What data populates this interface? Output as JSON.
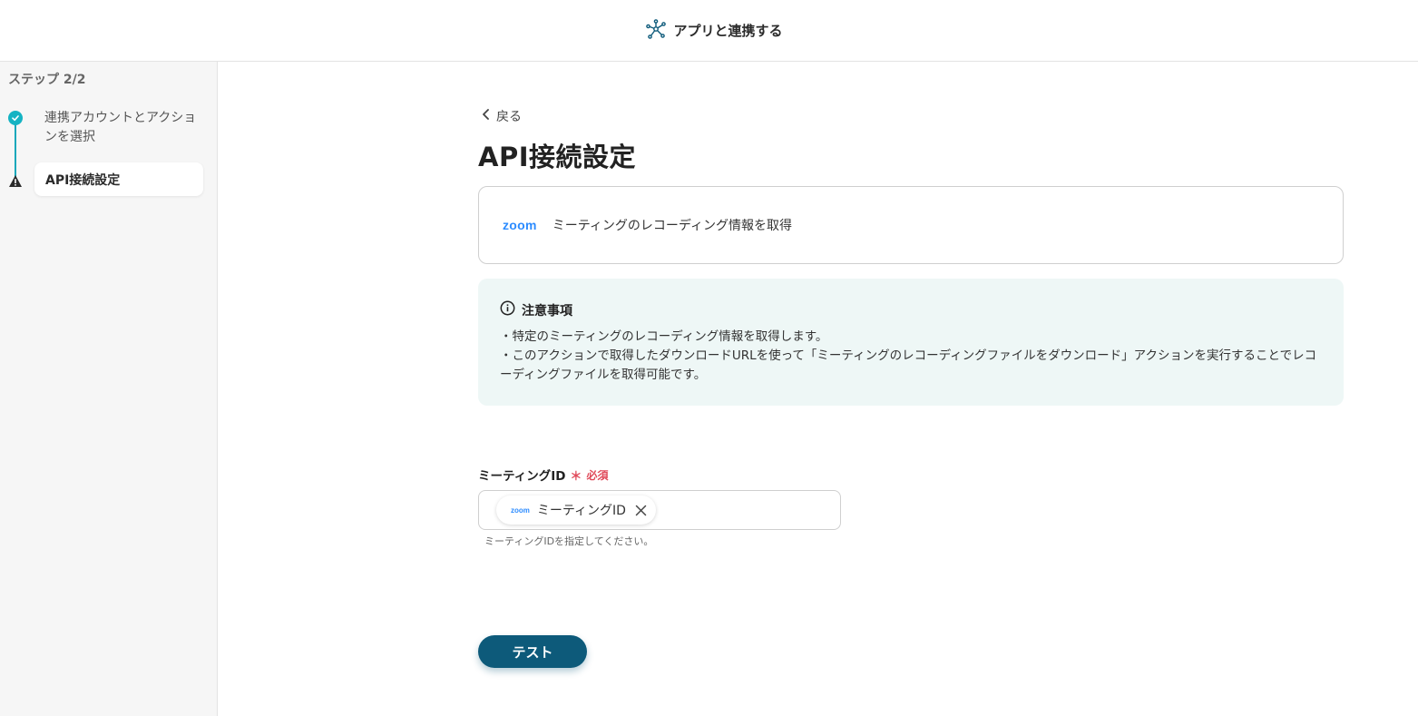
{
  "header": {
    "title": "アプリと連携する",
    "icon": "network-hub-icon"
  },
  "sidebar": {
    "step_count": "ステップ 2/2",
    "steps": [
      {
        "label": "連携アカウントとアクションを選択",
        "status": "done"
      },
      {
        "label": "API接続設定",
        "status": "current-warning"
      }
    ]
  },
  "main": {
    "back_label": "戻る",
    "title": "API接続設定",
    "action_card": {
      "app_logo": "zoom",
      "action_name": "ミーティングのレコーディング情報を取得"
    },
    "notice": {
      "heading": "注意事項",
      "lines": [
        "・特定のミーティングのレコーディング情報を取得します。",
        "・このアクションで取得したダウンロードURLを使って「ミーティングのレコーディングファイルをダウンロード」アクションを実行することでレコーディングファイルを取得可能です。"
      ]
    },
    "field": {
      "label": "ミーティングID",
      "required_mark": "＊",
      "required_text": "必須",
      "chip": {
        "app_logo": "zoom",
        "value": "ミーティングID"
      },
      "help": "ミーティングIDを指定してください。"
    },
    "test_button": "テスト"
  },
  "colors": {
    "accent_teal": "#15b3c3",
    "primary_button": "#0d5a7a",
    "required_red": "#e04a5a",
    "notice_bg": "#eef7f6",
    "zoom_blue": "#2d8cff"
  }
}
